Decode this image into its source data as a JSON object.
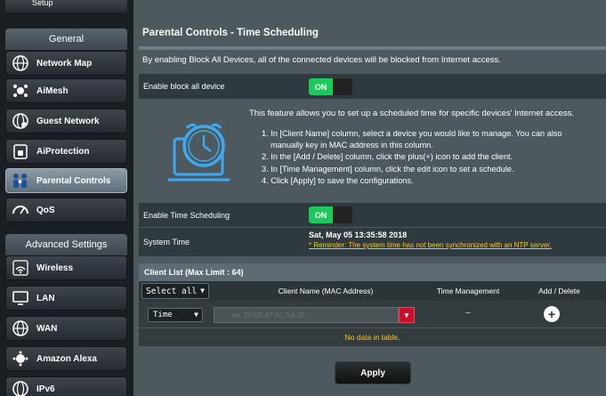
{
  "sidebar": {
    "top_partial_label": "Setup",
    "general_header": "General",
    "general_items": [
      {
        "label": "Network Map",
        "icon": "globe-network-icon"
      },
      {
        "label": "AiMesh",
        "icon": "mesh-icon"
      },
      {
        "label": "Guest Network",
        "icon": "guest-globe-icon"
      },
      {
        "label": "AiProtection",
        "icon": "lock-icon"
      },
      {
        "label": "Parental Controls",
        "icon": "family-icon"
      },
      {
        "label": "QoS",
        "icon": "gauge-icon"
      }
    ],
    "advanced_header": "Advanced Settings",
    "advanced_items": [
      {
        "label": "Wireless",
        "icon": "wifi-icon"
      },
      {
        "label": "LAN",
        "icon": "monitor-icon"
      },
      {
        "label": "WAN",
        "icon": "globe-icon"
      },
      {
        "label": "Amazon Alexa",
        "icon": "alexa-icon"
      },
      {
        "label": "IPv6",
        "icon": "ipv6-globe-icon"
      }
    ],
    "active_item": "Parental Controls"
  },
  "page": {
    "title": "Parental Controls - Time Scheduling",
    "description": "By enabling Block All Devices, all of the connected devices will be blocked from Internet access.",
    "block_all": {
      "label": "Enable block all device",
      "state": "ON"
    },
    "feature": {
      "intro": "This feature allows you to set up a scheduled time for specific devices' Internet access.",
      "steps": [
        "1. In [Client Name] column, select a device you would like to manage. You can also",
        "manually key in MAC address in this column.",
        "2. In the [Add / Delete] column, click the plus(+) icon to add the client.",
        "3. In [Time Management] column, click the edit icon to set a schedule.",
        "4. Click [Apply] to save the configurations."
      ]
    },
    "time_scheduling": {
      "label": "Enable Time Scheduling",
      "state": "ON"
    },
    "system_time": {
      "label": "System Time",
      "value": "Sat, May 05 13:35:58 2018",
      "reminder": "* Reminder: The system time has not been synchronized with an NTP server."
    },
    "client_list": {
      "header": "Client List (Max Limit : 64)",
      "select_all": "Select all",
      "columns": [
        "Client Name (MAC Address)",
        "Time Management",
        "Add / Delete"
      ],
      "row_mode": "Time",
      "mac_placeholder": "ex: 38:D5:47:AC:5A:3F",
      "time_mgmt_value": "–",
      "empty_text": "No data in table."
    },
    "apply_label": "Apply"
  },
  "colors": {
    "toggle_on": "#1ec95b",
    "reminder": "#ffcc00",
    "panel": "#4d595d",
    "dropdown_red": "#c8102e"
  }
}
